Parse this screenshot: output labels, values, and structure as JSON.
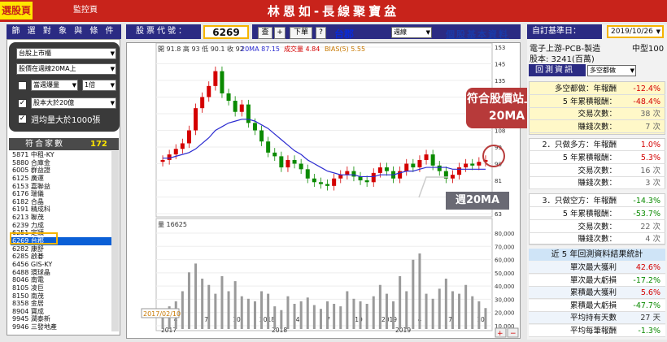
{
  "tabs": {
    "t1": "選股頁",
    "t2": "監控頁"
  },
  "app_title": "林恩如-長線聚寶盆",
  "left": {
    "header": "篩 選 對 象 與 條 件",
    "filters": [
      {
        "value": "台股上市櫃"
      },
      {
        "value": "股價在週線20MA上"
      },
      {
        "value": "當週爆量"
      },
      {
        "value": "1倍"
      },
      {
        "value": "股本大於20億"
      }
    ],
    "weekly_label": "週均量大於1000張",
    "count_label": "符合家數",
    "count_value": "172",
    "stocks": [
      "5871 中租-KY",
      "5880 合庫金",
      "6005 群益證",
      "6125 廣運",
      "6153 嘉聯益",
      "6176 瑞儀",
      "6182 合晶",
      "6191 精成科",
      "6213 聯茂",
      "6239 力成",
      "6251 定穎",
      "6269 台郡",
      "6282 康舒",
      "6285 啟碁",
      "6456 GIS-KY",
      "6488 環球晶",
      "8046 南電",
      "8105 凌巨",
      "8150 南茂",
      "8358 金居",
      "8904 寶成",
      "9945 潤泰新",
      "9946 三發地產"
    ],
    "selected_stock": "6269 台郡"
  },
  "mid": {
    "code_label": "股票代號：",
    "code": "6269",
    "btn_query": "查",
    "btn_plus": "+",
    "btn_next": "下單",
    "btn_help": "?",
    "stock_name": "台郡",
    "period": "週線",
    "link": "個股基本資料",
    "ohlc": "開 91.8  高 93  低 90.1  收 92",
    "ma": "20MA 87.15",
    "vol_label": "成交量 4.84",
    "bias": "BIAS(5) 5.55",
    "vol_caption": "量 16625",
    "date_start": "2017/02/10",
    "callout": "符合股價站上週20MA",
    "ma_label": "週20MA"
  },
  "right": {
    "base_label": "自訂基準日：",
    "base_date": "2019/10/26",
    "industry": "電子上游-PCB-製造",
    "size": "中型100",
    "capital": "股本: 3241(百萬)",
    "backtest_tab": "回測資訊",
    "dir_select": "多空都做",
    "s1": [
      {
        "l": "多空都做：年報酬",
        "v": "-12.4%"
      },
      {
        "l": "5 年累積報酬：",
        "v": "-48.4%"
      },
      {
        "l": "交易次數：",
        "v": "38 次"
      },
      {
        "l": "賺錢次數：",
        "v": "7 次"
      }
    ],
    "s2_title": "2．只做多方：年報酬",
    "s2_first": "1.0%",
    "s2": [
      {
        "l": "5 年累積報酬：",
        "v": "5.3%"
      },
      {
        "l": "交易次數：",
        "v": "16 次"
      },
      {
        "l": "賺錢次數：",
        "v": "3 次"
      }
    ],
    "s3_title": "3．只做空方：年報酬",
    "s3_first": "-14.3%",
    "s3": [
      {
        "l": "5 年累積報酬：",
        "v": "-53.7%"
      },
      {
        "l": "交易次數：",
        "v": "22 次"
      },
      {
        "l": "賺錢次數：",
        "v": "4 次"
      }
    ],
    "stats_title": "近 5 年回測資料結果統計",
    "stats": [
      {
        "l": "單次最大獲利",
        "v": "42.6%"
      },
      {
        "l": "單次最大虧損",
        "v": "-17.2%"
      },
      {
        "l": "累積最大獲利",
        "v": "5.6%"
      },
      {
        "l": "累積最大虧損",
        "v": "-47.7%"
      },
      {
        "l": "平均持有天數",
        "v": "27 天"
      },
      {
        "l": "平均每筆報酬",
        "v": "-1.3%"
      }
    ]
  },
  "chart_data": {
    "type": "line",
    "x_ticks": [
      "4",
      "7",
      "10",
      "2018",
      "4",
      "7",
      "10",
      "2019",
      "4",
      "7",
      "10"
    ],
    "x_years": [
      "2017",
      "2018",
      "2019"
    ],
    "price_ticks": [
      "153",
      "145",
      "135",
      "126",
      "117",
      "108",
      "99",
      "90",
      "81",
      "72",
      "63"
    ],
    "vol_ticks": [
      "80,000",
      "70,000",
      "60,000",
      "50,000",
      "40,000",
      "30,000",
      "20,000",
      "10,000"
    ],
    "close": [
      92,
      95,
      98,
      101,
      108,
      120,
      126,
      132,
      140,
      128,
      124,
      118,
      122,
      112,
      108,
      102,
      96,
      94,
      88,
      92,
      90,
      87,
      82,
      80,
      79,
      78,
      82,
      84,
      86,
      83,
      81,
      80,
      85,
      88,
      86,
      82,
      86,
      90,
      88,
      92,
      95,
      89,
      86,
      82,
      84,
      88,
      90,
      89,
      91,
      92
    ],
    "ma20": [
      93,
      93,
      94,
      95,
      96,
      98,
      101,
      104,
      108,
      110,
      112,
      113,
      114,
      114,
      113,
      111,
      109,
      106,
      103,
      100,
      97,
      95,
      92,
      90,
      88,
      86,
      85,
      84,
      84,
      84,
      83,
      83,
      83,
      84,
      84,
      84,
      85,
      86,
      86,
      87,
      88,
      88,
      88,
      88,
      87,
      87,
      87,
      87,
      87,
      87
    ],
    "volume": [
      12000,
      18000,
      22000,
      30000,
      45000,
      52000,
      40000,
      35000,
      28000,
      42000,
      30000,
      38000,
      26000,
      24000,
      22000,
      30000,
      28000,
      18000,
      15000,
      26000,
      20000,
      22000,
      25000,
      19000,
      16000,
      22000,
      20000,
      18000,
      30000,
      24000,
      22000,
      20000,
      26000,
      35000,
      28000,
      22000,
      42000,
      30000,
      55000,
      60000,
      28000,
      24000,
      32000,
      40000,
      30000,
      28000,
      35000,
      26000,
      22000,
      16625
    ],
    "price_ylim": [
      63,
      153
    ],
    "vol_ylim": [
      0,
      80000
    ]
  }
}
